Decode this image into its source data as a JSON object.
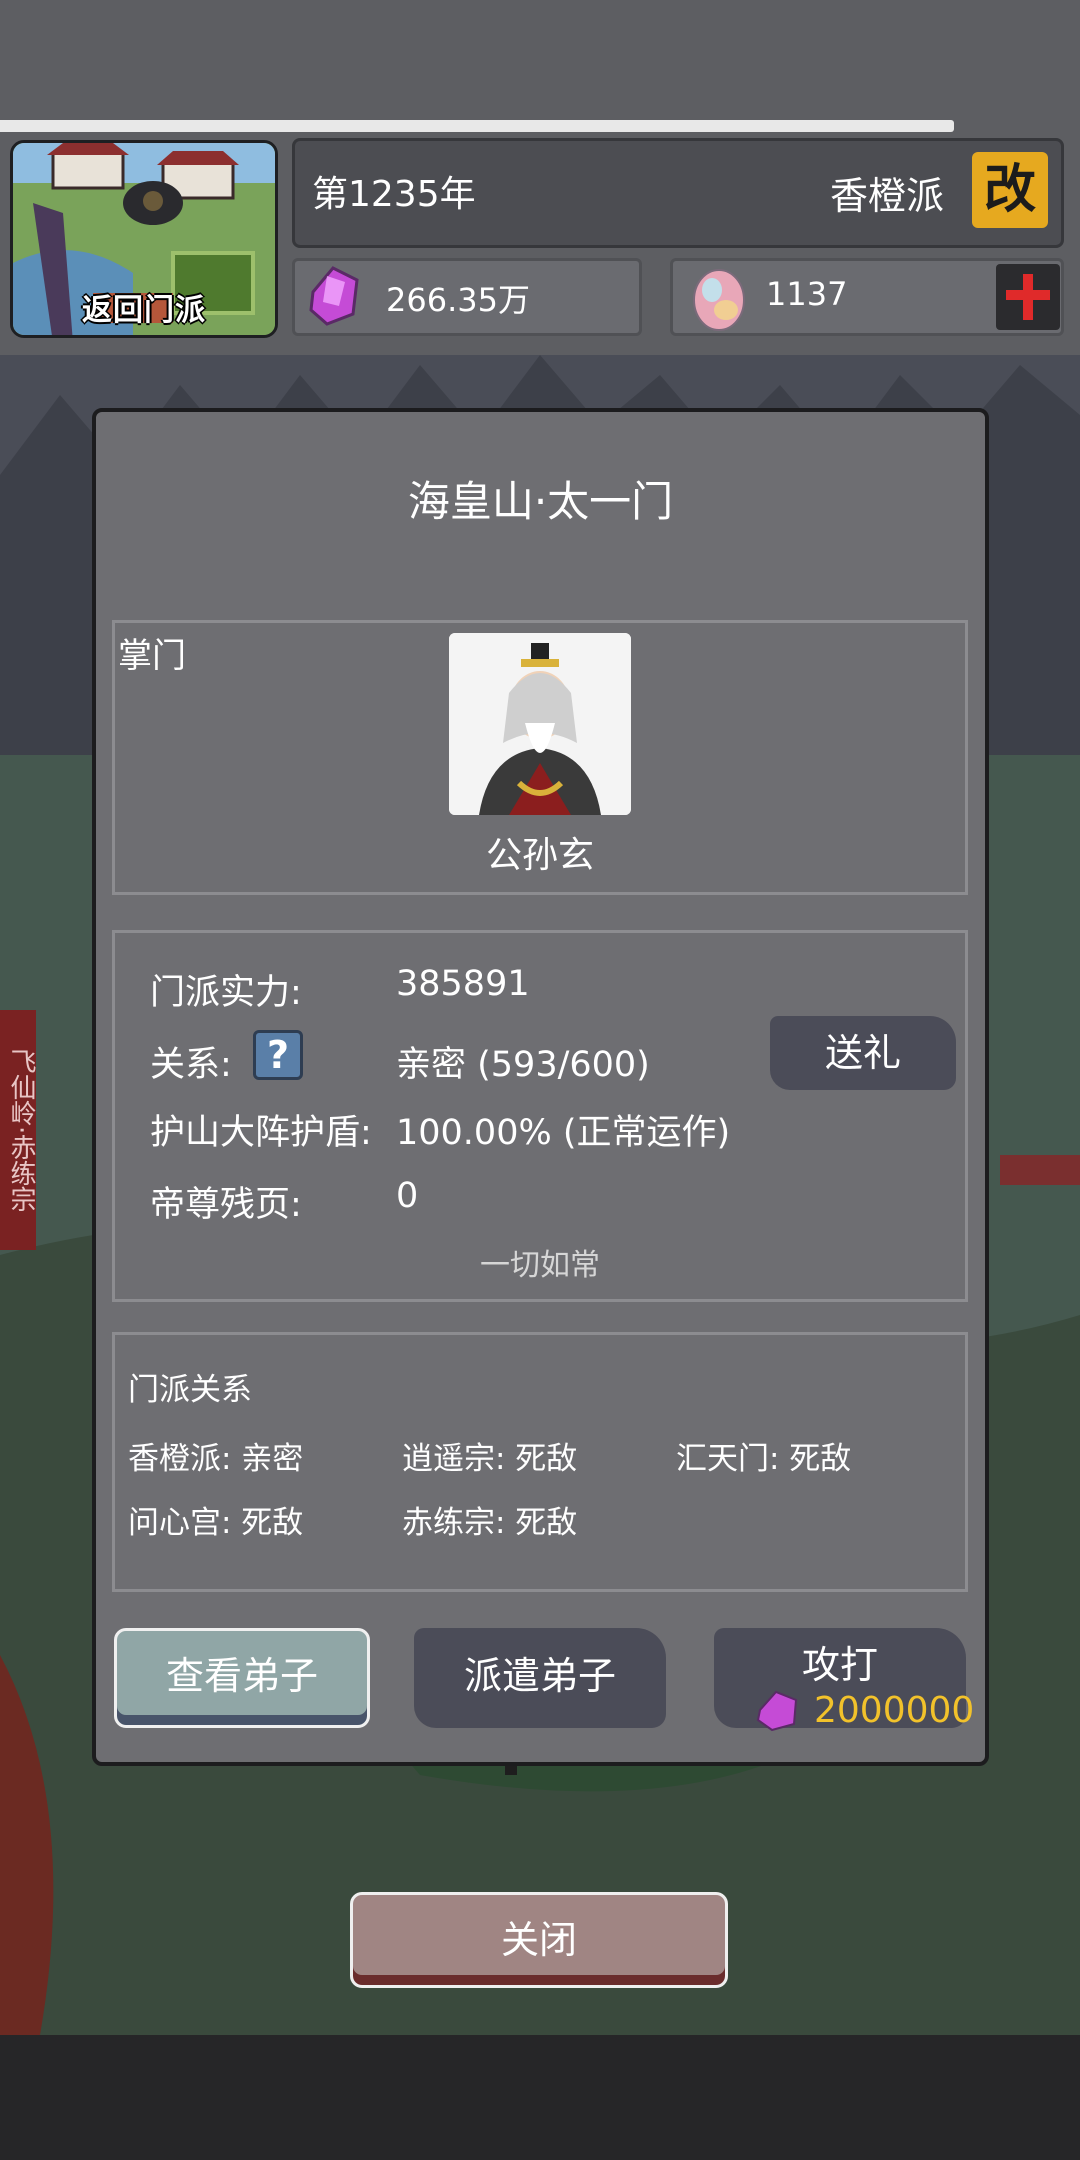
{
  "header": {
    "home_label": "返回门派",
    "year": "第1235年",
    "sect_name": "香橙派",
    "rename_icon_text": "改",
    "spirit_stones": "266.35万",
    "eggs": "1137"
  },
  "side_tag": "飞仙岭·赤练宗",
  "dialog": {
    "title": "海皇山·太一门",
    "leader": {
      "label": "掌门",
      "name": "公孙玄"
    },
    "stats": {
      "strength_label": "门派实力:",
      "strength_value": "385891",
      "relation_label": "关系:",
      "relation_value": "亲密  (593/600)",
      "shield_label": "护山大阵护盾:",
      "shield_value": "100.00% (正常运作)",
      "pages_label": "帝尊残页:",
      "pages_value": "0",
      "status_note": "一切如常",
      "gift_button": "送礼",
      "help_icon": "?"
    },
    "relations": {
      "title": "门派关系",
      "items": [
        "香橙派: 亲密",
        "逍遥宗: 死敌",
        "汇天门: 死敌",
        "问心宫: 死敌",
        "赤练宗: 死敌"
      ]
    },
    "actions": {
      "view_disciples": "查看弟子",
      "send_disciples": "派遣弟子",
      "attack": "攻打",
      "attack_cost": "2000000"
    }
  },
  "close_button": "关闭",
  "colors": {
    "rename_bg": "#e6a91f",
    "attack_cost": "#f2c22b",
    "close_bg": "#a08583",
    "view_bg": "#90a6a6"
  }
}
